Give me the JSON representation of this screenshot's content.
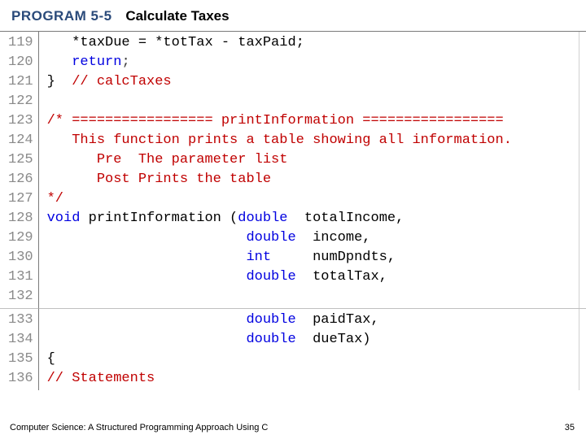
{
  "header": {
    "program_label": "PROGRAM 5-5",
    "title": "Calculate Taxes"
  },
  "gutter_a": [
    "119",
    "120",
    "121",
    "122",
    "123",
    "124",
    "125",
    "126",
    "127",
    "128",
    "129",
    "130",
    "131",
    "132"
  ],
  "gutter_b": [
    "133",
    "134",
    "135",
    "136"
  ],
  "lines": {
    "l119": "   *taxDue = *totTax - taxPaid;",
    "l120_kw": "return",
    "l121_brace": "}",
    "l121_cmt": "  // calcTaxes",
    "l122": "",
    "l123": "/* ================= printInformation =================",
    "l124": "   This function prints a table showing all information.",
    "l125": "      Pre  The parameter list",
    "l126": "      Post Prints the table",
    "l127": "*/",
    "l128_kw": "void",
    "l128_rest": " printInformation (",
    "l128_kw2": "double",
    "l128_p1": "  totalIncome,",
    "l129_kw": "double",
    "l129_p": "  income,",
    "l130_kw": "int",
    "l130_p": "     numDpndts,",
    "l131_kw": "double",
    "l131_p": "  totalTax,",
    "l132": "",
    "l133_kw": "double",
    "l133_p": "  paidTax,",
    "l134_kw": "double",
    "l134_p": "  dueTax)",
    "l135": "{",
    "l136": "// Statements"
  },
  "pad56": "                        ",
  "pad3": "   ",
  "semicolon": ";",
  "footer": {
    "left": "Computer Science: A Structured Programming Approach Using C",
    "right": "35"
  }
}
